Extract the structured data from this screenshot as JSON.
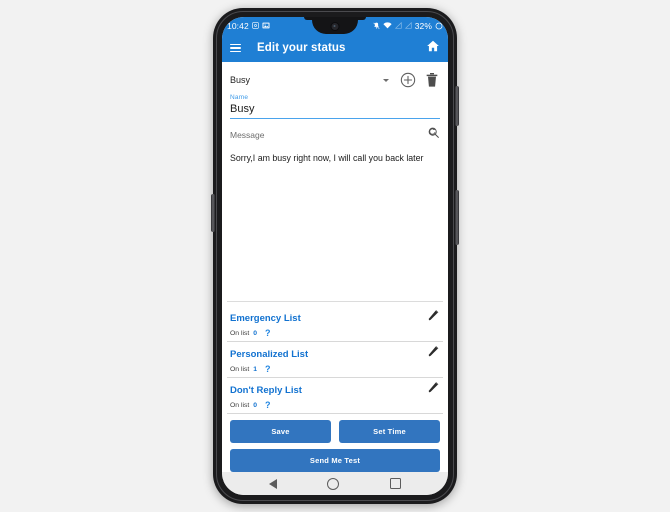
{
  "status_bar": {
    "time": "10:42",
    "left_icons": [
      "screenshot-icon",
      "gallery-icon"
    ],
    "right_icons": [
      "notification-mute-icon",
      "wifi-icon",
      "sim1-signal-icon",
      "sim2-signal-icon"
    ],
    "battery_percent": "32%",
    "battery_icon": "battery-circle-icon"
  },
  "app_bar": {
    "menu_icon": "hamburger-menu-icon",
    "title": "Edit your status",
    "home_icon": "home-icon"
  },
  "spinner": {
    "selected": "Busy",
    "caret_icon": "chevron-down-icon",
    "add_icon": "plus-circle-icon",
    "delete_icon": "trash-icon"
  },
  "name_field": {
    "label": "Name",
    "value": "Busy"
  },
  "message_field": {
    "label": "Message",
    "action_icon": "search-refresh-icon",
    "value": "Sorry,I am busy right now, I will call you back later"
  },
  "lists": [
    {
      "title": "Emergency List",
      "on_list_label": "On list",
      "count": "0",
      "help_icon": "question-mark-icon",
      "edit_icon": "pencil-edit-icon"
    },
    {
      "title": "Personalized List",
      "on_list_label": "On list",
      "count": "1",
      "help_icon": "question-mark-icon",
      "edit_icon": "pencil-edit-icon"
    },
    {
      "title": "Don't Reply List",
      "on_list_label": "On list",
      "count": "0",
      "help_icon": "question-mark-icon",
      "edit_icon": "pencil-edit-icon"
    }
  ],
  "buttons": {
    "save": "Save",
    "set_time": "Set Time",
    "send_me_test": "Send Me Test"
  },
  "nav_bar": {
    "back_icon": "triangle-back-icon",
    "home_icon": "circle-home-icon",
    "recents_icon": "square-recents-icon"
  },
  "colors": {
    "primary_blue": "#1f7fd4",
    "button_blue": "#3275bf",
    "link_blue": "#1272d0",
    "accent_underline": "#4aa3ec",
    "page_background": "#f2f2f2"
  }
}
